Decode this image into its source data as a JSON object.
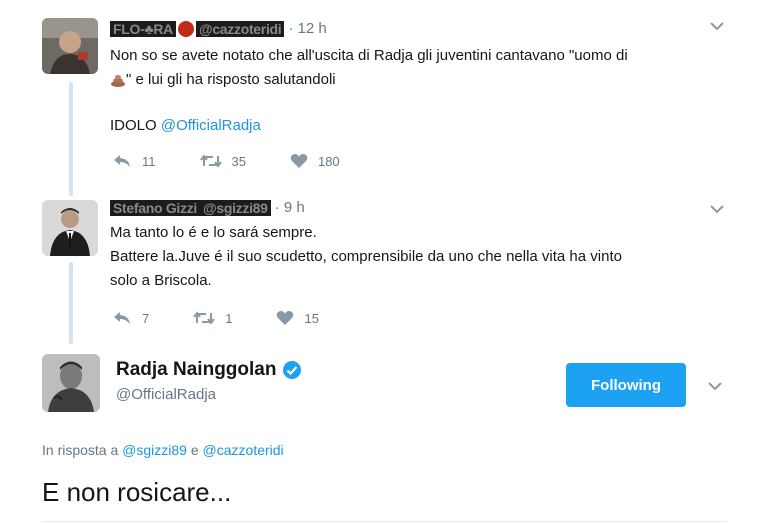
{
  "thread": [
    {
      "display_name": "FLO-♣RA",
      "handle": "@cazzoteridi",
      "time": "· 12 h",
      "text_line1": "Non so se avete notato che all'uscita di Radja gli juventini cantavano \"uomo di",
      "text_line2_suffix": "\" e lui gli ha risposto salutandoli",
      "text_line3_prefix": "IDOLO ",
      "text_line3_mention": "@OfficialRadja",
      "replies": "11",
      "retweets": "35",
      "likes": "180"
    },
    {
      "display_name": "Stefano Gizzi",
      "handle": "@sgizzi89",
      "time": "· 9 h",
      "text_line1": "Ma tanto lo é e lo sará sempre.",
      "text_line2": "Battere la.Juve é il suo scudetto, comprensibile da uno che nella vita ha vinto",
      "text_line3": "solo a Briscola.",
      "replies": "7",
      "retweets": "1",
      "likes": "15"
    }
  ],
  "main_tweet": {
    "name": "Radja Nainggolan",
    "handle": "@OfficialRadja",
    "follow_label": "Following",
    "reply_prefix": "In risposta a ",
    "reply_mention_1": "@sgizzi89",
    "reply_joiner": " e ",
    "reply_mention_2": "@cazzoteridi",
    "text": "E non rosicare..."
  },
  "colors": {
    "accent": "#1da1f2",
    "link": "#1b95e0",
    "muted": "#657786",
    "thread_line": "#cfe5f3"
  }
}
